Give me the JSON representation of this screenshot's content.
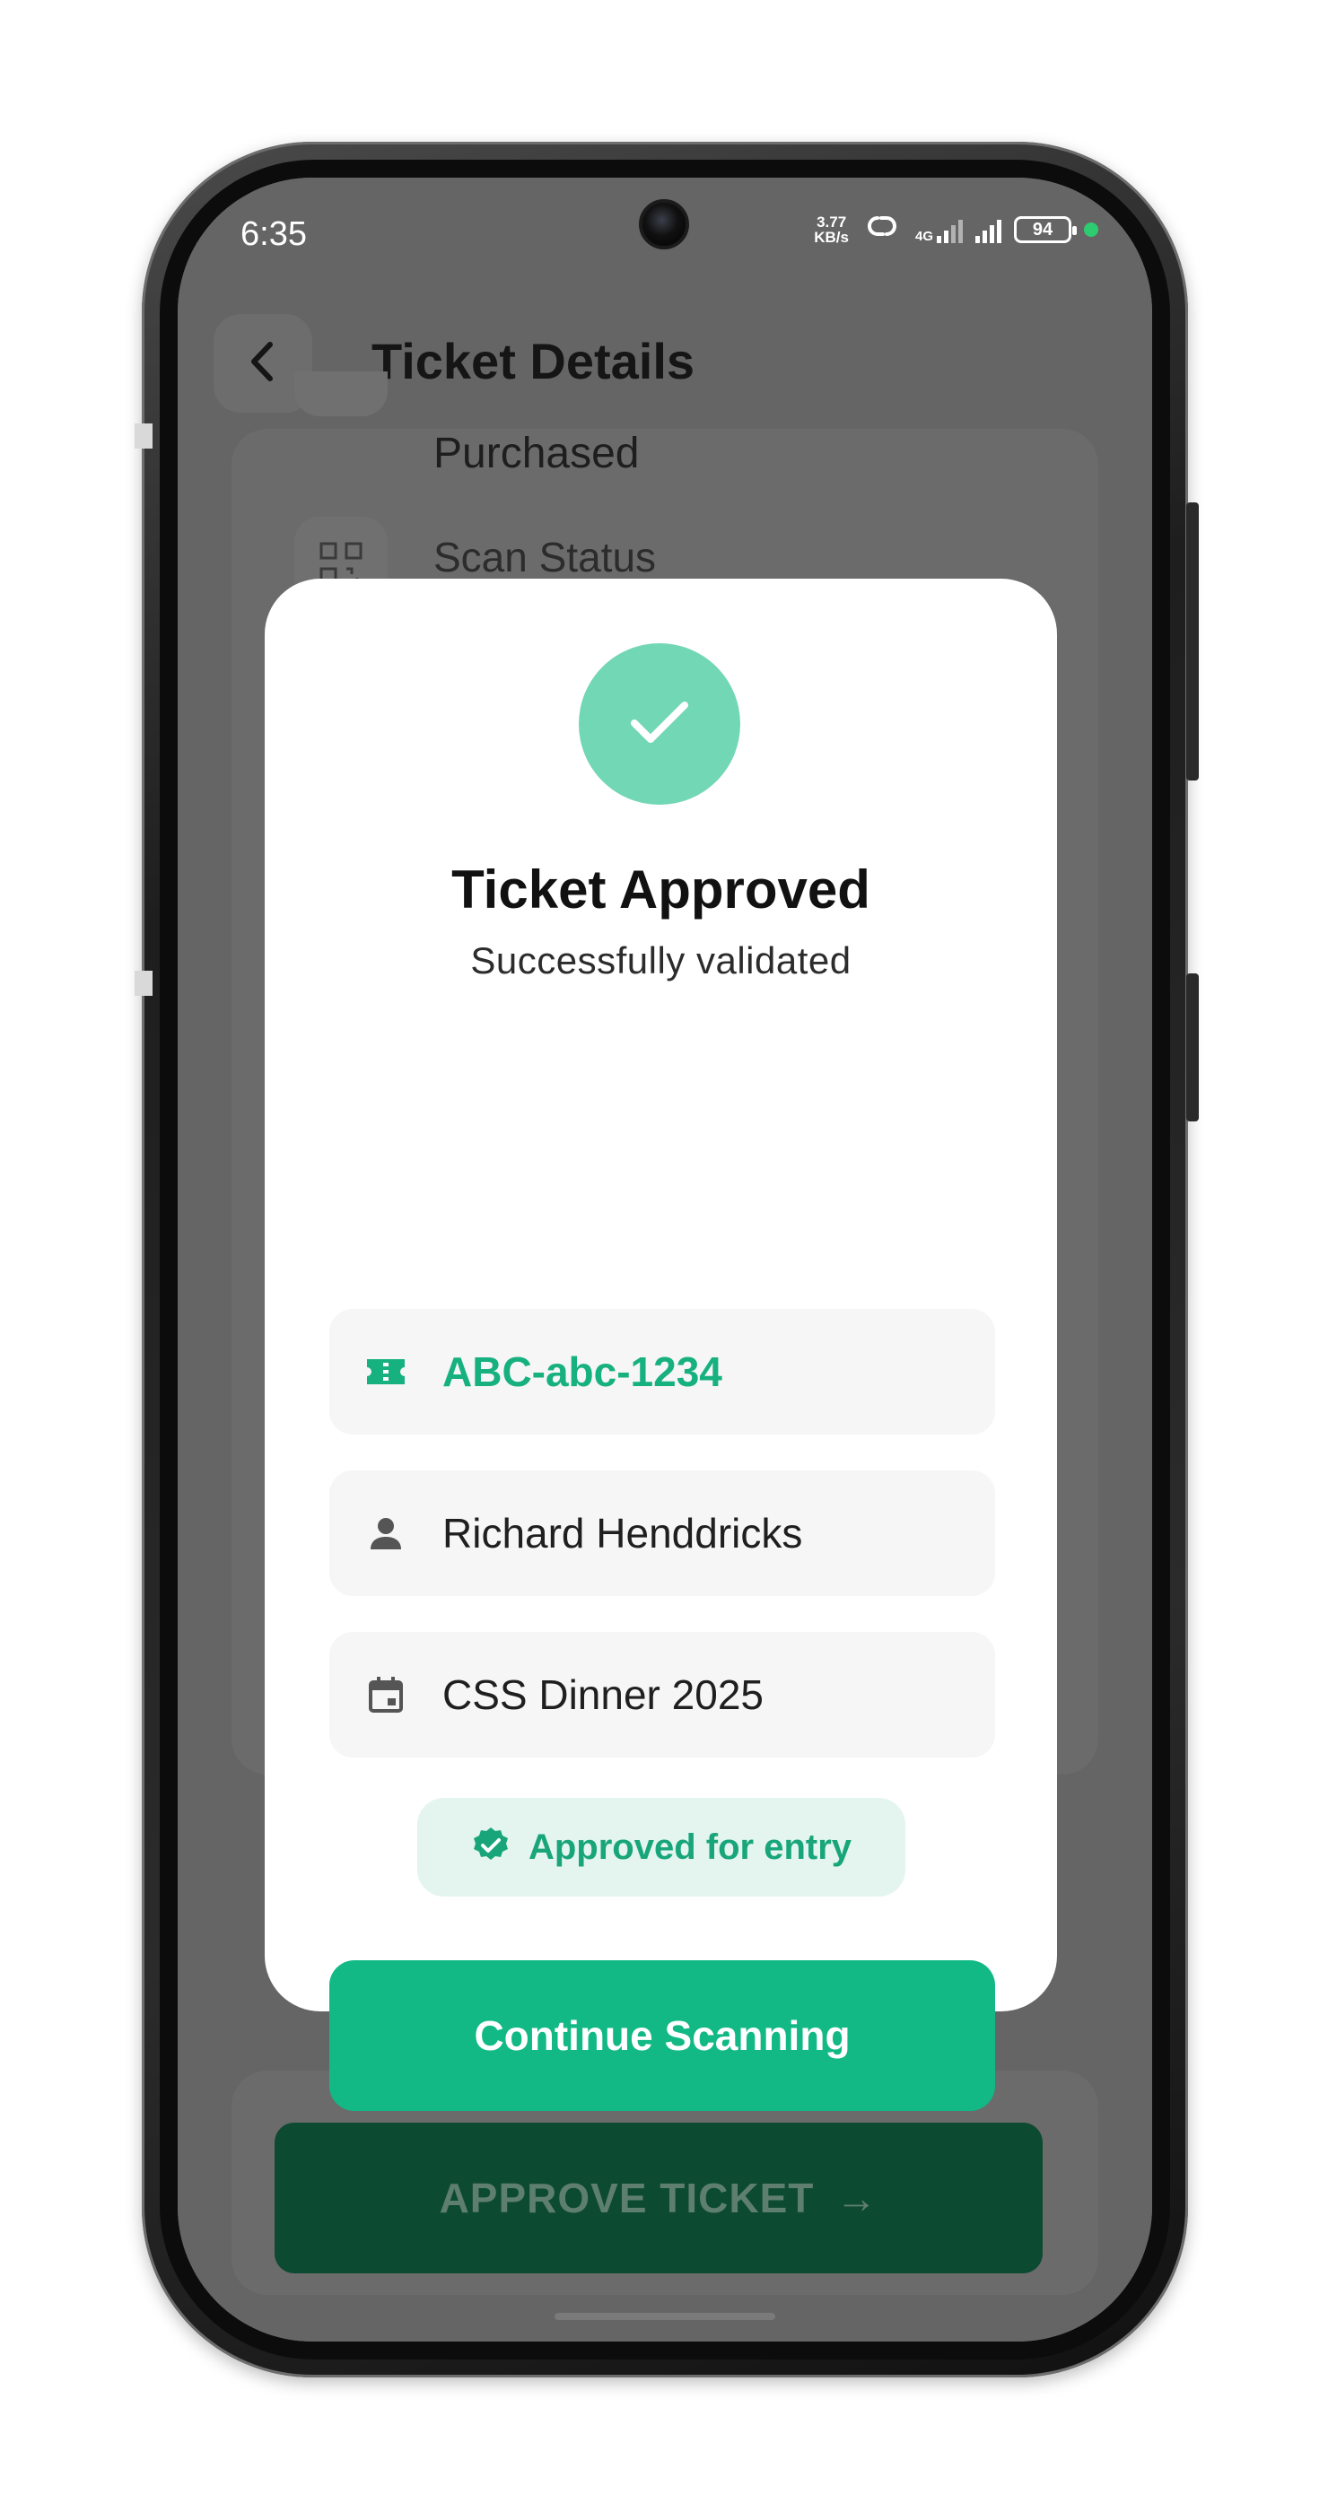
{
  "status_bar": {
    "time": "6:35",
    "net_speed_value": "3.77",
    "net_speed_unit": "KB/s",
    "network_type": "4G",
    "battery": "94"
  },
  "header": {
    "title": "Ticket Details"
  },
  "background_details": {
    "purchased_label": "Purchased",
    "scan_status_label": "Scan Status"
  },
  "modal": {
    "title": "Ticket Approved",
    "subtitle": "Successfully validated",
    "ticket_code": "ABC-abc-1234",
    "attendee_name": "Richard Henddricks",
    "event_name": "CSS Dinner 2025",
    "badge_text": "Approved for entry",
    "continue_label": "Continue Scanning"
  },
  "bottom": {
    "approve_label": "APPROVE TICKET",
    "approve_arrow": "→"
  },
  "icons": {
    "back": "chevron-left-icon",
    "qr": "qr-code-icon",
    "check": "check-icon",
    "ticket": "ticket-icon",
    "person": "person-icon",
    "calendar": "calendar-icon",
    "verified": "verified-badge-icon"
  },
  "colors": {
    "accent_green": "#12b985",
    "success_circle": "#72d7b4",
    "badge_bg": "#e3f5ee",
    "approve_button_dim": "#0d4a32",
    "overlay_grey": "#656565"
  }
}
